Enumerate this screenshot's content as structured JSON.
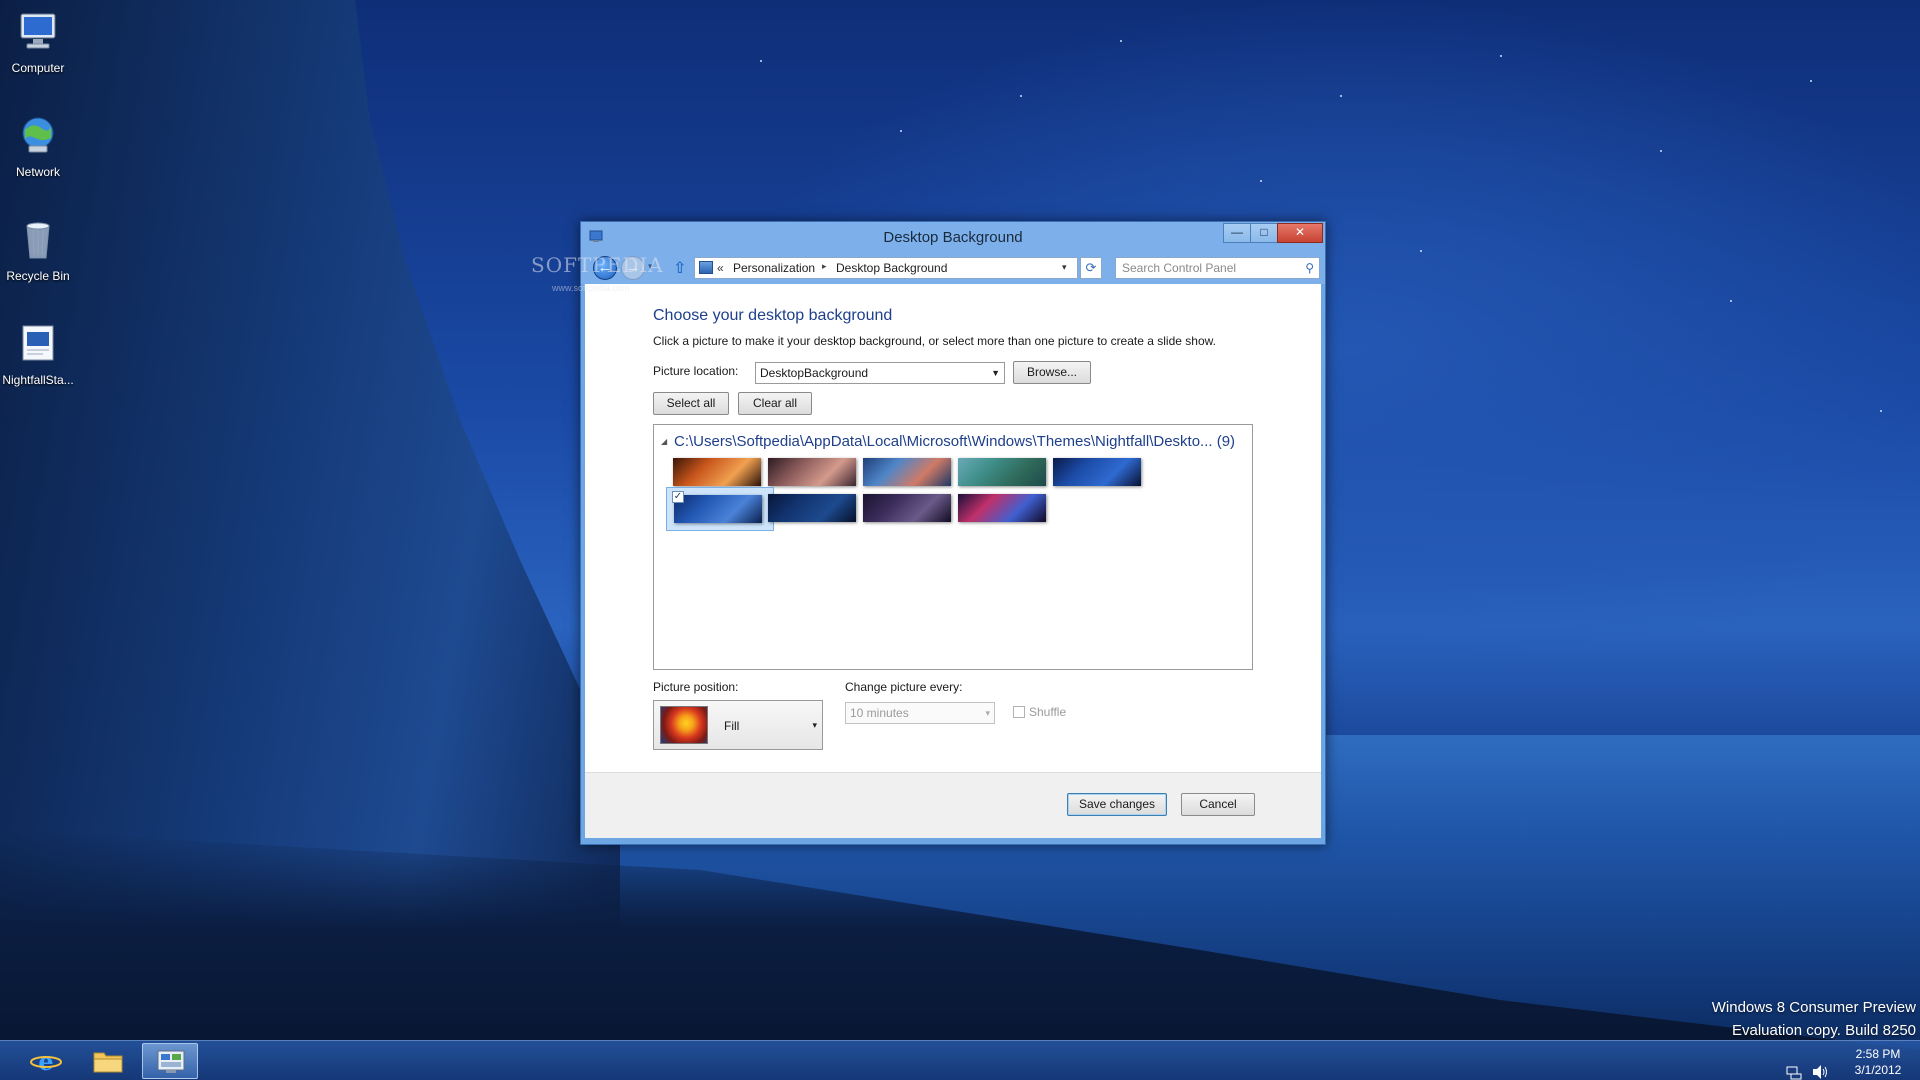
{
  "desktop": {
    "icons": [
      {
        "label": "Computer",
        "icon": "computer-icon"
      },
      {
        "label": "Network",
        "icon": "network-icon"
      },
      {
        "label": "Recycle Bin",
        "icon": "recycle-bin-icon"
      },
      {
        "label": "NightfallSta...",
        "icon": "document-icon"
      }
    ],
    "watermark": "SOFTPEDIA",
    "watermark_url": "www.softpedia.com",
    "build_info": {
      "line1": "Windows 8 Consumer Preview",
      "line2": "Evaluation copy. Build 8250"
    }
  },
  "window": {
    "title": "Desktop Background",
    "caption_buttons": {
      "minimize": "—",
      "maximize": "□",
      "close": "✕"
    },
    "navigation": {
      "back": "←",
      "forward": "→",
      "recent": "▾",
      "up": "⇧",
      "address_chevron": "«",
      "breadcrumbs": [
        "Personalization",
        "Desktop Background"
      ],
      "breadcrumb_separator": "▸",
      "address_dropdown": "▾",
      "refresh": "⟳",
      "search_placeholder": "Search Control Panel",
      "search_icon": "⚲"
    },
    "heading": "Choose your desktop background",
    "description": "Click a picture to make it your desktop background, or select more than one picture to create a slide show.",
    "picture_location": {
      "label": "Picture location:",
      "value": "DesktopBackground",
      "browse_label": "Browse..."
    },
    "select_all_label": "Select all",
    "clear_all_label": "Clear all",
    "gallery": {
      "collapse_glyph": "◢",
      "folder_path": "C:\\Users\\Softpedia\\AppData\\Local\\Microsoft\\Windows\\Themes\\Nightfall\\Deskto... (9)",
      "thumbnails": [
        {
          "name": "wallpaper-1",
          "selected": false,
          "colors": [
            "#3a1608",
            "#c8551c",
            "#f0a050",
            "#2a1208"
          ]
        },
        {
          "name": "wallpaper-2",
          "selected": false,
          "colors": [
            "#2b1b22",
            "#8a5a5a",
            "#d49a8c",
            "#3a2630"
          ]
        },
        {
          "name": "wallpaper-3",
          "selected": false,
          "colors": [
            "#1f3e78",
            "#4f86c8",
            "#d07a66",
            "#1c3868"
          ]
        },
        {
          "name": "wallpaper-4",
          "selected": false,
          "colors": [
            "#6aa9b8",
            "#3f8f8a",
            "#2f6a5a",
            "#1d4a4a"
          ]
        },
        {
          "name": "wallpaper-5",
          "selected": false,
          "colors": [
            "#0a1a4a",
            "#1c4ca8",
            "#2f6ad0",
            "#071233"
          ]
        },
        {
          "name": "wallpaper-6",
          "selected": true,
          "colors": [
            "#0c2a6a",
            "#2358b4",
            "#4a82d8",
            "#0a1f4d"
          ]
        },
        {
          "name": "wallpaper-7",
          "selected": false,
          "colors": [
            "#08163a",
            "#12346f",
            "#1d4a8e",
            "#06102a"
          ]
        },
        {
          "name": "wallpaper-8",
          "selected": false,
          "colors": [
            "#1a1430",
            "#3a2c5a",
            "#6a5a8a",
            "#120d22"
          ]
        },
        {
          "name": "wallpaper-9",
          "selected": false,
          "colors": [
            "#1a0f3a",
            "#c0306a",
            "#4060d0",
            "#100826"
          ]
        }
      ],
      "check_glyph": "✓"
    },
    "picture_position": {
      "label": "Picture position:",
      "value": "Fill",
      "arrow": "▾"
    },
    "change_picture": {
      "label": "Change picture every:",
      "value": "10 minutes",
      "arrow": "▾"
    },
    "shuffle_label": "Shuffle",
    "save_label": "Save changes",
    "cancel_label": "Cancel"
  },
  "taskbar": {
    "buttons": [
      {
        "name": "internet-explorer",
        "icon": "ie-icon"
      },
      {
        "name": "file-explorer",
        "icon": "folder-icon"
      },
      {
        "name": "control-panel",
        "icon": "control-panel-icon",
        "active": true
      }
    ],
    "clock_time": "2:58 PM",
    "clock_date": "3/1/2012"
  }
}
